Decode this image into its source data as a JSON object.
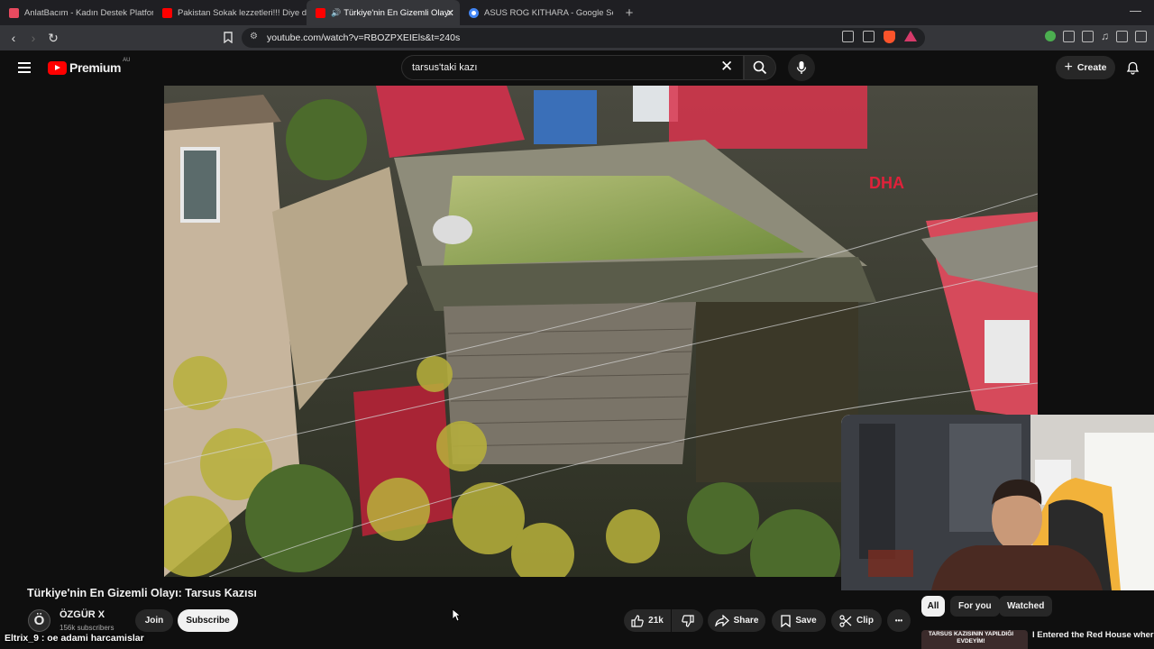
{
  "browser": {
    "tabs": [
      {
        "label": "AnlatBacım - Kadın Destek Platformu",
        "favicon_color": "#e84a5f",
        "active": false
      },
      {
        "label": "Pakistan Sokak lezzetleri!!! Diye diye",
        "favicon_color": "#ff0000",
        "active": false
      },
      {
        "label": "Türkiye'nin En Gizemli Olayı: ",
        "favicon_color": "#ff0000",
        "active": true
      },
      {
        "label": "ASUS ROG KITHARA - Google Search",
        "favicon_color": "#4285f4",
        "active": false
      }
    ],
    "tab_close": "✕",
    "new_tab": "+",
    "url": "youtube.com/watch?v=RBOZPXEIEls&t=240s"
  },
  "header": {
    "logo_text": "Premium",
    "logo_region": "AU",
    "search_query": "tarsus'taki kazı",
    "create_label": "Create"
  },
  "overlay": {
    "watermark": "DHA"
  },
  "video": {
    "title": "Türkiye'nin En Gizemli Olayı: Tarsus Kazısı",
    "channel_initial": "Ö",
    "channel_name": "ÖZGÜR X",
    "subscribers": "156k subscribers",
    "join_label": "Join",
    "subscribe_label": "Subscribe",
    "like_count": "21k",
    "share_label": "Share",
    "save_label": "Save",
    "clip_label": "Clip",
    "more_label": "•••"
  },
  "chips": [
    "All",
    "For you",
    "Watched"
  ],
  "recommendation": {
    "thumb_text": "TARSUS KAZISININ YAPILDIĞI EVDEYİM!",
    "title": "I Entered the Red House where the Excavation in Tarsus was..."
  },
  "stream_chat": {
    "message": "Eltrix_9 : oe adami harcamislar"
  },
  "colors": {
    "youtube_red": "#ff0000",
    "background": "#0f0f0f",
    "button_bg": "#272727"
  }
}
